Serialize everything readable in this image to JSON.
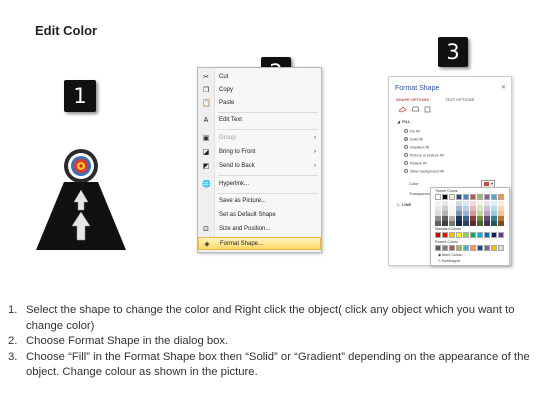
{
  "page": {
    "title": "Edit Color"
  },
  "badges": [
    "1",
    "2",
    "3"
  ],
  "context_menu": {
    "items": [
      {
        "label": "Cut",
        "icon": "scissors-icon",
        "glyph": "✂",
        "disabled": false,
        "submenu": false
      },
      {
        "label": "Copy",
        "icon": "copy-icon",
        "glyph": "❐",
        "disabled": false,
        "submenu": false
      },
      {
        "label": "Paste",
        "icon": "paste-icon",
        "glyph": "📋",
        "disabled": false,
        "submenu": false
      },
      {
        "label": "Edit Text",
        "icon": "edit-text-icon",
        "glyph": "A",
        "disabled": false,
        "submenu": false
      },
      {
        "label": "Group",
        "icon": "group-icon",
        "glyph": "▣",
        "disabled": true,
        "submenu": true
      },
      {
        "label": "Bring to Front",
        "icon": "bring-to-front-icon",
        "glyph": "◪",
        "disabled": false,
        "submenu": true
      },
      {
        "label": "Send to Back",
        "icon": "send-to-back-icon",
        "glyph": "◩",
        "disabled": false,
        "submenu": true
      },
      {
        "label": "Hyperlink...",
        "icon": "hyperlink-icon",
        "glyph": "🌐",
        "disabled": false,
        "submenu": false
      },
      {
        "label": "Save as Picture...",
        "icon": "",
        "glyph": "",
        "disabled": false,
        "submenu": false
      },
      {
        "label": "Set as Default Shape",
        "icon": "",
        "glyph": "",
        "disabled": false,
        "submenu": false
      },
      {
        "label": "Size and Position...",
        "icon": "size-position-icon",
        "glyph": "⊡",
        "disabled": false,
        "submenu": false
      },
      {
        "label": "Format Shape...",
        "icon": "format-shape-icon",
        "glyph": "◈",
        "disabled": false,
        "submenu": false,
        "highlighted": true
      }
    ]
  },
  "format_pane": {
    "title": "Format Shape",
    "tabs": [
      "SHAPE OPTIONS",
      "TEXT OPTIONS"
    ],
    "fill_section": "FILL",
    "fill_options": [
      "No fill",
      "Solid fill",
      "Gradient fill",
      "Picture or texture fill",
      "Pattern fill",
      "Slide background fill"
    ],
    "selected_fill": "Solid fill",
    "color_label": "Color",
    "transparency_label": "Transparency",
    "line_section": "LINE",
    "palette": {
      "theme_colors": "Theme Colors",
      "standard_colors": "Standard Colors",
      "recent_colors": "Recent Colors",
      "more_colors": "More Colors...",
      "eyedropper": "Eyedropper",
      "theme_top": [
        "#ffffff",
        "#000000",
        "#eeece1",
        "#1f497d",
        "#4f81bd",
        "#c0504d",
        "#9bbb59",
        "#8064a2",
        "#4bacc6",
        "#f79646"
      ],
      "standard": [
        "#c00000",
        "#ff0000",
        "#ffc000",
        "#ffff00",
        "#92d050",
        "#00b050",
        "#00b0f0",
        "#0070c0",
        "#002060",
        "#7030a0"
      ],
      "recent": [
        "#595959",
        "#7f7f7f",
        "#c0504d",
        "#9bbb59",
        "#4bacc6",
        "#f79646",
        "#1f497d",
        "#8064a2",
        "#ffc000",
        "#d9d9d9"
      ]
    }
  },
  "instructions": [
    {
      "num": "1.",
      "text": "Select the shape to change the color and Right click the object( click any object which you want to change color)"
    },
    {
      "num": "2.",
      "text": "Choose Format Shape in the dialog box."
    },
    {
      "num": "3.",
      "text": "Choose “Fill” in the Format Shape box then “Solid” or “Gradient” depending on the appearance of the object. Change colour as shown in the picture."
    }
  ]
}
